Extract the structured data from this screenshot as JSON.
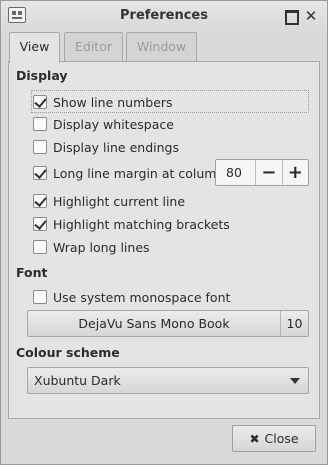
{
  "window": {
    "title": "Preferences",
    "close_glyph": "✕"
  },
  "tabs": [
    {
      "label": "View",
      "active": true
    },
    {
      "label": "Editor",
      "active": false
    },
    {
      "label": "Window",
      "active": false
    }
  ],
  "display": {
    "heading": "Display",
    "options": [
      {
        "label": "Show line numbers",
        "checked": true
      },
      {
        "label": "Display whitespace",
        "checked": false
      },
      {
        "label": "Display line endings",
        "checked": false
      },
      {
        "label": "Long line margin at column:",
        "checked": true
      },
      {
        "label": "Highlight current line",
        "checked": true
      },
      {
        "label": "Highlight matching brackets",
        "checked": true
      },
      {
        "label": "Wrap long lines",
        "checked": false
      }
    ],
    "margin_column": {
      "value": "80",
      "minus": "−",
      "plus": "+"
    }
  },
  "font": {
    "heading": "Font",
    "use_system": {
      "label": "Use system monospace font",
      "checked": false
    },
    "font_name": "DejaVu Sans Mono Book",
    "font_size": "10"
  },
  "colour_scheme": {
    "heading": "Colour scheme",
    "selected": "Xubuntu Dark"
  },
  "footer": {
    "close_label": "Close",
    "close_glyph": "✖"
  }
}
